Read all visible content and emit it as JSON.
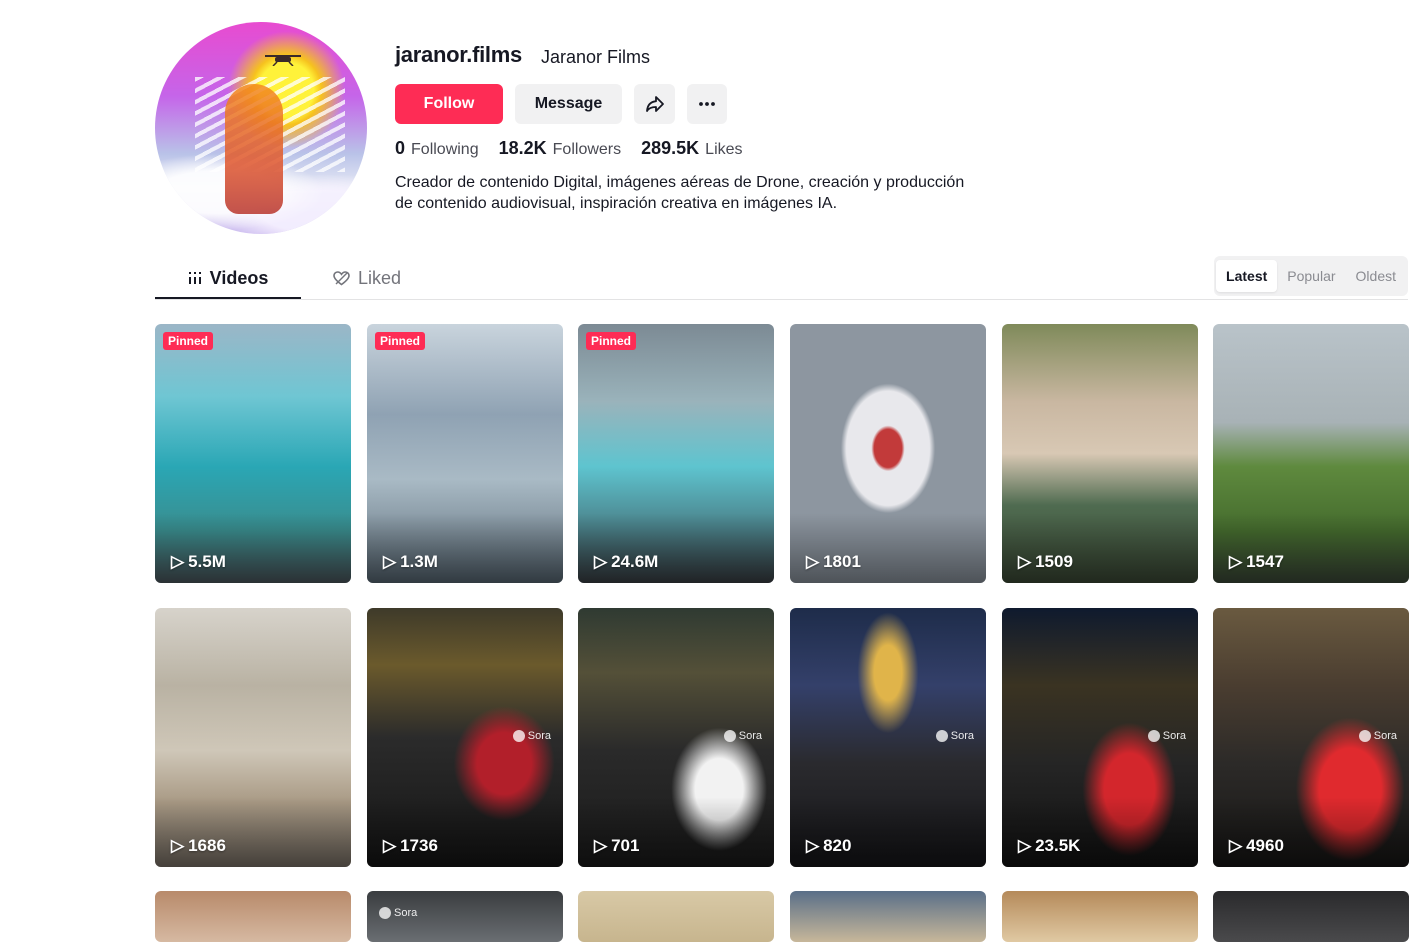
{
  "profile": {
    "username": "jaranor.films",
    "nickname": "Jaranor Films",
    "bio_line1": "Creador de contenido Digital, imágenes aéreas de Drone, creación y producción",
    "bio_line2": "de contenido audiovisual, inspiración creativa en imágenes IA."
  },
  "actions": {
    "follow_label": "Follow",
    "message_label": "Message",
    "share_icon": "share-icon",
    "more_icon": "more-icon"
  },
  "stats": {
    "following_value": "0",
    "following_label": "Following",
    "followers_value": "18.2K",
    "followers_label": "Followers",
    "likes_value": "289.5K",
    "likes_label": "Likes"
  },
  "tabs": {
    "videos_label": "Videos",
    "liked_label": "Liked"
  },
  "sort": {
    "latest": "Latest",
    "popular": "Popular",
    "oldest": "Oldest",
    "active": "Latest"
  },
  "videos": [
    {
      "views": "5.5M",
      "pinned": "Pinned"
    },
    {
      "views": "1.3M",
      "pinned": "Pinned"
    },
    {
      "views": "24.6M",
      "pinned": "Pinned"
    },
    {
      "views": "1801"
    },
    {
      "views": "1509"
    },
    {
      "views": "1547"
    },
    {
      "views": "1686"
    },
    {
      "views": "1736",
      "watermark": "Sora"
    },
    {
      "views": "701",
      "watermark": "Sora"
    },
    {
      "views": "820",
      "watermark": "Sora"
    },
    {
      "views": "23.5K",
      "watermark": "Sora"
    },
    {
      "views": "4960",
      "watermark": "Sora"
    }
  ],
  "partial_row_watermark": "Sora",
  "colors": {
    "accent": "#fe2c55",
    "text": "#161823",
    "muted": "#73747b"
  }
}
